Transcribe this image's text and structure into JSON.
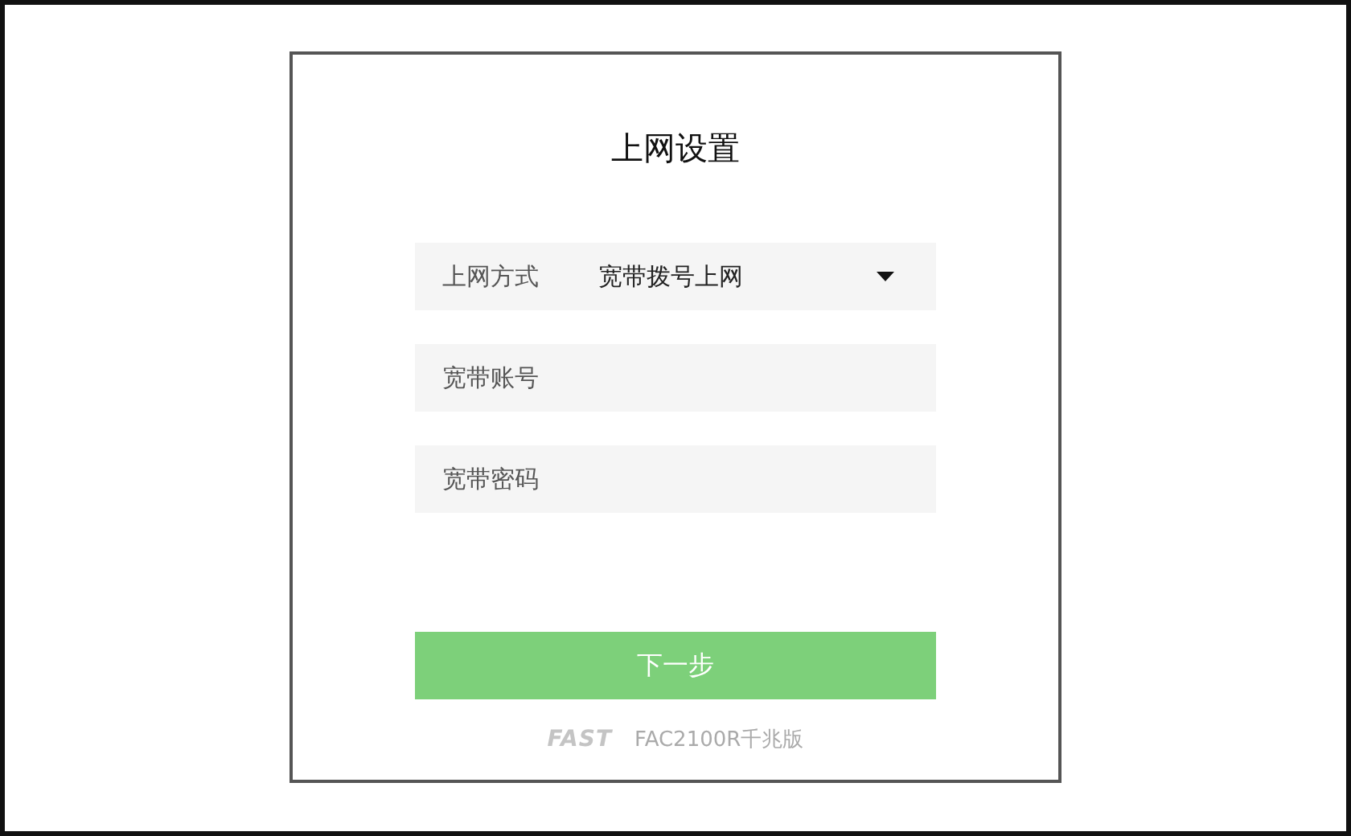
{
  "title": "上网设置",
  "connection": {
    "label": "上网方式",
    "value": "宽带拨号上网"
  },
  "fields": [
    {
      "placeholder": "宽带账号"
    },
    {
      "placeholder": "宽带密码"
    }
  ],
  "next_button": "下一步",
  "footer": {
    "brand": "FAST",
    "model": "FAC2100R千兆版"
  }
}
